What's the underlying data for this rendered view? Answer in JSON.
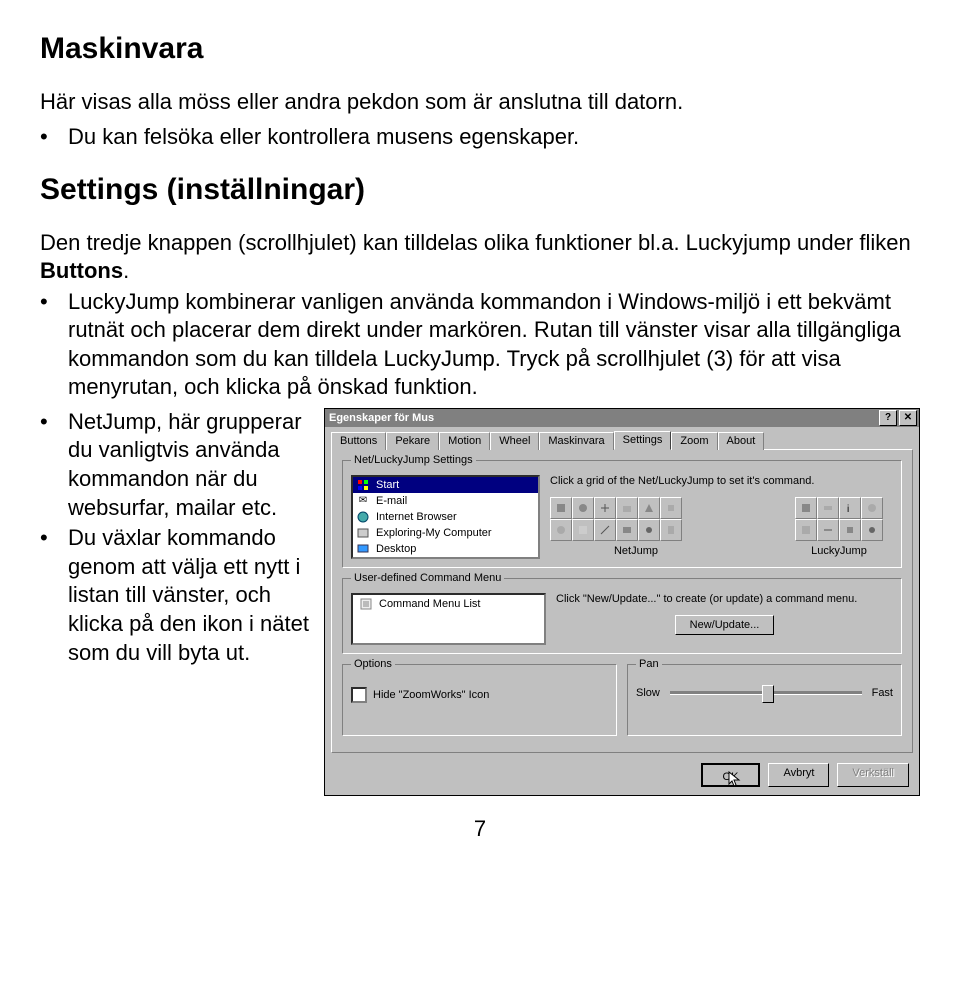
{
  "heading1": "Maskinvara",
  "intro": "Här visas alla möss eller andra pekdon som är anslutna till datorn.",
  "bullet1": "Du kan felsöka eller kontrollera musens egenskaper.",
  "heading2": "Settings (inställningar)",
  "sub_intro_a": "Den tredje knappen (scrollhjulet) kan tilldelas olika funktioner bl.a. Luckyjump under fliken ",
  "sub_intro_b": "Buttons",
  "sub_intro_c": ".",
  "bullet2": "LuckyJump kombinerar vanligen använda kommandon i Windows-miljö i ett bekvämt rutnät och placerar dem direkt under markören. Rutan till vänster visar alla tillgängliga kommandon som du kan tilldela LuckyJump. Tryck på scrollhjulet (3) för att visa menyrutan, och klicka på önskad funktion.",
  "bullet3": "NetJump, här grupperar du vanligtvis använda kommandon när du websurfar, mailar etc.",
  "bullet4": "Du växlar kommando genom att välja ett nytt i listan till vänster, och klicka på den ikon i nätet som du vill byta ut.",
  "page_number": "7",
  "dialog": {
    "title": "Egenskaper för Mus",
    "help_btn": "?",
    "close_btn": "✕",
    "tabs": [
      "Buttons",
      "Pekare",
      "Motion",
      "Wheel",
      "Maskinvara",
      "Settings",
      "Zoom",
      "About"
    ],
    "group_nl": "Net/LuckyJump Settings",
    "nl_help": "Click a grid of the Net/LuckyJump to set it's command.",
    "list_items": [
      "Start",
      "E-mail",
      "Internet Browser",
      "Exploring-My Computer",
      "Desktop"
    ],
    "grid1_label": "NetJump",
    "grid2_label": "LuckyJump",
    "group_cmd": "User-defined Command Menu",
    "cmd_item": "Command Menu List",
    "cmd_help": "Click \"New/Update...\" to create (or update) a command menu.",
    "cmd_btn": "New/Update...",
    "group_opts": "Options",
    "chk_label": "Hide \"ZoomWorks\" Icon",
    "group_pan": "Pan",
    "pan_slow": "Slow",
    "pan_fast": "Fast",
    "btn_ok": "OK",
    "btn_cancel": "Avbryt",
    "btn_apply": "Verkställ"
  }
}
